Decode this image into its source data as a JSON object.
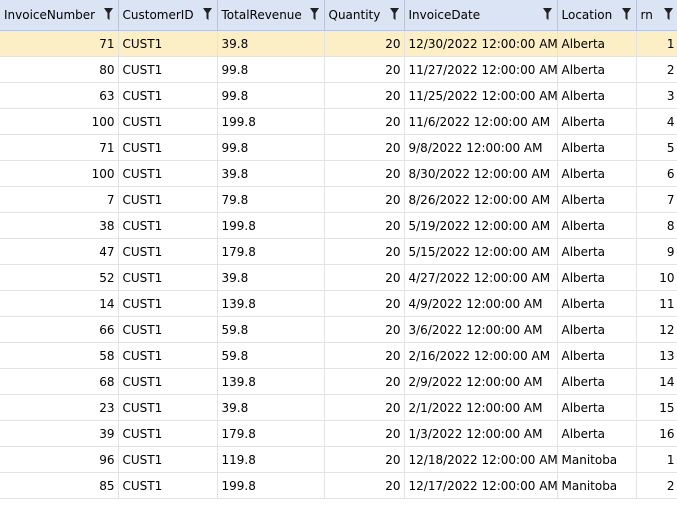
{
  "columns": [
    {
      "label": "InvoiceNumber",
      "align": "right"
    },
    {
      "label": "CustomerID",
      "align": "left"
    },
    {
      "label": "TotalRevenue",
      "align": "left"
    },
    {
      "label": "Quantity",
      "align": "right"
    },
    {
      "label": "InvoiceDate",
      "align": "left"
    },
    {
      "label": "Location",
      "align": "left"
    },
    {
      "label": "rn",
      "align": "right"
    }
  ],
  "selected_row": 0,
  "colors": {
    "header_bg": "#dae4f5",
    "selected_row_bg": "#fcefc6",
    "grid_line": "#e3e3e3"
  },
  "filter_icon": "filter-icon",
  "rows": [
    [
      "71",
      "CUST1",
      "39.8",
      "20",
      "12/30/2022 12:00:00 AM",
      "Alberta",
      "1"
    ],
    [
      "80",
      "CUST1",
      "99.8",
      "20",
      "11/27/2022 12:00:00 AM",
      "Alberta",
      "2"
    ],
    [
      "63",
      "CUST1",
      "99.8",
      "20",
      "11/25/2022 12:00:00 AM",
      "Alberta",
      "3"
    ],
    [
      "100",
      "CUST1",
      "199.8",
      "20",
      "11/6/2022 12:00:00 AM",
      "Alberta",
      "4"
    ],
    [
      "71",
      "CUST1",
      "99.8",
      "20",
      "9/8/2022 12:00:00 AM",
      "Alberta",
      "5"
    ],
    [
      "100",
      "CUST1",
      "39.8",
      "20",
      "8/30/2022 12:00:00 AM",
      "Alberta",
      "6"
    ],
    [
      "7",
      "CUST1",
      "79.8",
      "20",
      "8/26/2022 12:00:00 AM",
      "Alberta",
      "7"
    ],
    [
      "38",
      "CUST1",
      "199.8",
      "20",
      "5/19/2022 12:00:00 AM",
      "Alberta",
      "8"
    ],
    [
      "47",
      "CUST1",
      "179.8",
      "20",
      "5/15/2022 12:00:00 AM",
      "Alberta",
      "9"
    ],
    [
      "52",
      "CUST1",
      "39.8",
      "20",
      "4/27/2022 12:00:00 AM",
      "Alberta",
      "10"
    ],
    [
      "14",
      "CUST1",
      "139.8",
      "20",
      "4/9/2022 12:00:00 AM",
      "Alberta",
      "11"
    ],
    [
      "66",
      "CUST1",
      "59.8",
      "20",
      "3/6/2022 12:00:00 AM",
      "Alberta",
      "12"
    ],
    [
      "58",
      "CUST1",
      "59.8",
      "20",
      "2/16/2022 12:00:00 AM",
      "Alberta",
      "13"
    ],
    [
      "68",
      "CUST1",
      "139.8",
      "20",
      "2/9/2022 12:00:00 AM",
      "Alberta",
      "14"
    ],
    [
      "23",
      "CUST1",
      "39.8",
      "20",
      "2/1/2022 12:00:00 AM",
      "Alberta",
      "15"
    ],
    [
      "39",
      "CUST1",
      "179.8",
      "20",
      "1/3/2022 12:00:00 AM",
      "Alberta",
      "16"
    ],
    [
      "96",
      "CUST1",
      "119.8",
      "20",
      "12/18/2022 12:00:00 AM",
      "Manitoba",
      "1"
    ],
    [
      "85",
      "CUST1",
      "199.8",
      "20",
      "12/17/2022 12:00:00 AM",
      "Manitoba",
      "2"
    ]
  ]
}
